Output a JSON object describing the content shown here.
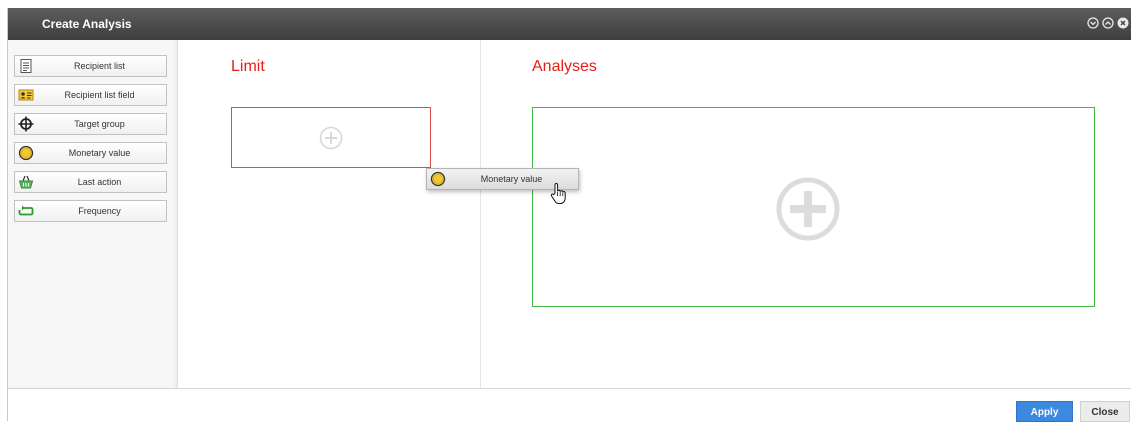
{
  "window": {
    "title": "Create Analysis",
    "controls": [
      "collapse-icon",
      "expand-icon",
      "close-icon"
    ]
  },
  "sidebar": {
    "items": [
      {
        "label": "Recipient list",
        "icon": "document-list-icon"
      },
      {
        "label": "Recipient list field",
        "icon": "contact-card-icon"
      },
      {
        "label": "Target group",
        "icon": "crosshair-icon"
      },
      {
        "label": "Monetary value",
        "icon": "coin-icon"
      },
      {
        "label": "Last action",
        "icon": "shopping-basket-icon"
      },
      {
        "label": "Frequency",
        "icon": "repeat-icon"
      }
    ]
  },
  "main": {
    "limit_title": "Limit",
    "analyses_title": "Analyses",
    "drag_item_label": "Monetary value"
  },
  "footer": {
    "apply_label": "Apply",
    "close_label": "Close"
  },
  "colors": {
    "accent_red": "#e32019",
    "drop_green": "#42b842",
    "apply_blue": "#3b8ae0"
  }
}
